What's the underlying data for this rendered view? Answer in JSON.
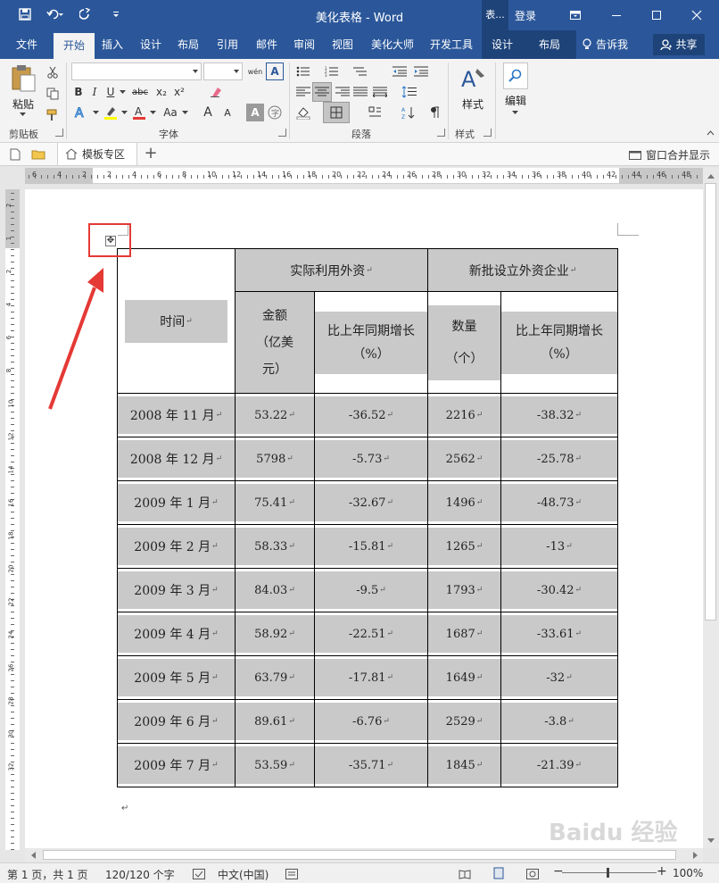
{
  "window": {
    "title": "美化表格 - Word",
    "context_tab_title": "表...",
    "login": "登录"
  },
  "ribbon_tabs": [
    {
      "label": "文件"
    },
    {
      "label": "开始"
    },
    {
      "label": "插入"
    },
    {
      "label": "设计"
    },
    {
      "label": "布局"
    },
    {
      "label": "引用"
    },
    {
      "label": "邮件"
    },
    {
      "label": "审阅"
    },
    {
      "label": "视图"
    },
    {
      "label": "美化大师"
    },
    {
      "label": "开发工具"
    },
    {
      "label": "设计"
    },
    {
      "label": "布局"
    }
  ],
  "tell_me": "告诉我",
  "share": "共享",
  "ribbon": {
    "paste": "粘贴",
    "groups": {
      "clipboard": "剪贴板",
      "font": "字体",
      "paragraph": "段落",
      "styles": "样式"
    },
    "styles_button": "样式",
    "edit_button": "编辑",
    "font_buttons": [
      "B",
      "I",
      "U",
      "abc",
      "x₂",
      "x²"
    ],
    "font_size_buttons": [
      "A",
      "Aa",
      "A",
      "A"
    ],
    "font_box_buttons": [
      "wén",
      "A"
    ]
  },
  "docbar": {
    "template_tab": "模板专区",
    "merge_windows": "窗口合并显示"
  },
  "table": {
    "corner_header": "时间",
    "group_headers": [
      "实际利用外资",
      "新批设立外资企业"
    ],
    "sub_headers": [
      {
        "line1": "金额",
        "line2": "（亿美",
        "line3": "元）"
      },
      {
        "line1": "比上年同期增长",
        "line2": "（%）"
      },
      {
        "line1": "数量",
        "line2": "（个）"
      },
      {
        "line1": "比上年同期增长",
        "line2": "（%）"
      }
    ],
    "rows": [
      {
        "time": "2008 年 11 月",
        "amount": "53.22",
        "amount_growth": "-36.52",
        "count": "2216",
        "count_growth": "-38.32"
      },
      {
        "time": "2008 年 12 月",
        "amount": "5798",
        "amount_growth": "-5.73",
        "count": "2562",
        "count_growth": "-25.78"
      },
      {
        "time": "2009 年 1 月",
        "amount": "75.41",
        "amount_growth": "-32.67",
        "count": "1496",
        "count_growth": "-48.73"
      },
      {
        "time": "2009 年 2 月",
        "amount": "58.33",
        "amount_growth": "-15.81",
        "count": "1265",
        "count_growth": "-13"
      },
      {
        "time": "2009 年 3 月",
        "amount": "84.03",
        "amount_growth": "-9.5",
        "count": "1793",
        "count_growth": "-30.42"
      },
      {
        "time": "2009 年 4 月",
        "amount": "58.92",
        "amount_growth": "-22.51",
        "count": "1687",
        "count_growth": "-33.61"
      },
      {
        "time": "2009 年 5 月",
        "amount": "63.79",
        "amount_growth": "-17.81",
        "count": "1649",
        "count_growth": "-32"
      },
      {
        "time": "2009 年 6 月",
        "amount": "89.61",
        "amount_growth": "-6.76",
        "count": "2529",
        "count_growth": "-3.8"
      },
      {
        "time": "2009 年 7 月",
        "amount": "53.59",
        "amount_growth": "-35.71",
        "count": "1845",
        "count_growth": "-21.39"
      }
    ]
  },
  "status": {
    "page": "第 1 页，共 1 页",
    "words": "120/120 个字",
    "language": "中文(中国)",
    "zoom": "100%"
  },
  "watermark": "Baidu 经验",
  "colors": {
    "word_blue": "#2b579a",
    "cell_gray": "#c9c9c9",
    "annotation_red": "#e53935"
  },
  "ruler": {
    "h_numbers": [
      "6",
      "4",
      "2",
      "2",
      "4",
      "6",
      "8",
      "10",
      "12",
      "14",
      "16",
      "18",
      "20",
      "22",
      "24",
      "26",
      "28",
      "30",
      "32",
      "34",
      "36",
      "38",
      "40",
      "42",
      "44",
      "46",
      "48"
    ],
    "v_numbers": [
      "2",
      "1",
      "2",
      "4",
      "6",
      "8",
      "10",
      "12",
      "14",
      "16",
      "18",
      "20",
      "22",
      "24",
      "26",
      "28",
      "30",
      "32"
    ]
  }
}
